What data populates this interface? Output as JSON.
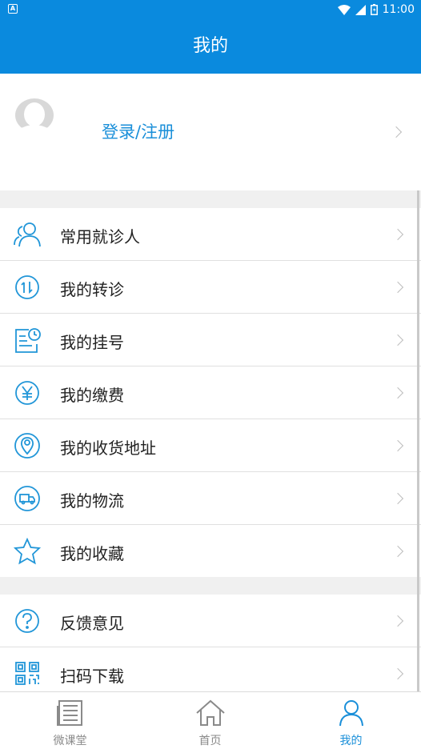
{
  "status_bar": {
    "time": "11:00"
  },
  "app_bar": {
    "title": "我的"
  },
  "profile": {
    "login_label": "登录/注册"
  },
  "menu_group_1": [
    {
      "label": "常用就诊人",
      "icon": "people-icon"
    },
    {
      "label": "我的转诊",
      "icon": "transfer-icon"
    },
    {
      "label": "我的挂号",
      "icon": "registration-icon"
    },
    {
      "label": "我的缴费",
      "icon": "yen-icon"
    },
    {
      "label": "我的收货地址",
      "icon": "location-pin-icon"
    },
    {
      "label": "我的物流",
      "icon": "truck-icon"
    },
    {
      "label": "我的收藏",
      "icon": "star-icon"
    }
  ],
  "menu_group_2": [
    {
      "label": "反馈意见",
      "icon": "question-icon"
    },
    {
      "label": "扫码下载",
      "icon": "qr-code-icon"
    }
  ],
  "tab_bar": [
    {
      "label": "微课堂",
      "icon": "newspaper-icon",
      "active": false
    },
    {
      "label": "首页",
      "icon": "home-icon",
      "active": false
    },
    {
      "label": "我的",
      "icon": "person-icon",
      "active": true
    }
  ],
  "colors": {
    "primary": "#0a8ade",
    "accent_text": "#1a8fd9",
    "icon_blue": "#2196d8"
  }
}
